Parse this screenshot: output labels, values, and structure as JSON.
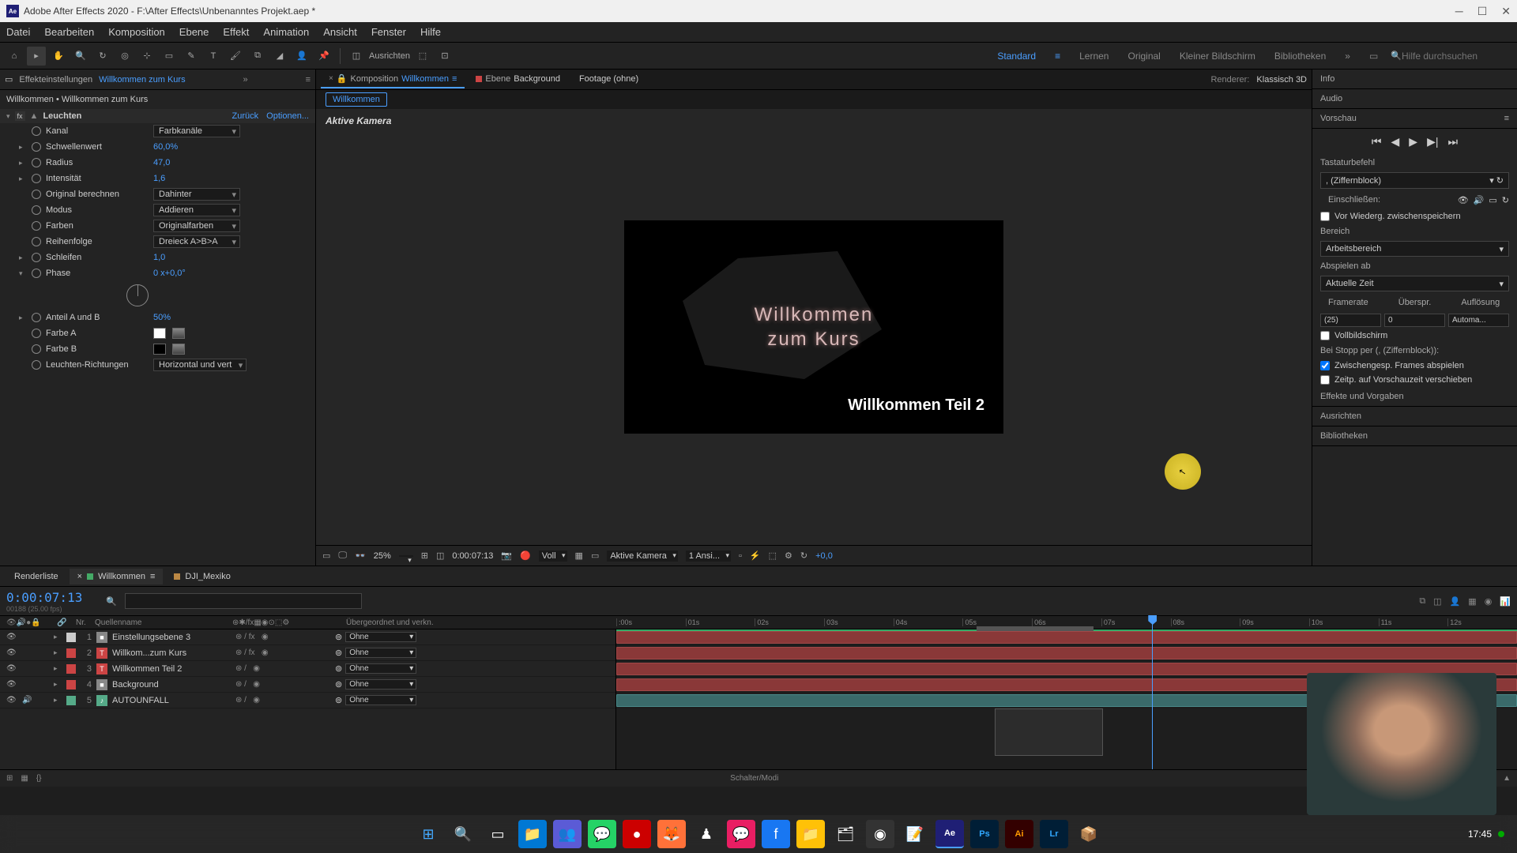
{
  "titlebar": {
    "app": "Adobe After Effects 2020",
    "path": "F:\\After Effects\\Unbenanntes Projekt.aep *"
  },
  "menu": [
    "Datei",
    "Bearbeiten",
    "Komposition",
    "Ebene",
    "Effekt",
    "Animation",
    "Ansicht",
    "Fenster",
    "Hilfe"
  ],
  "toolbar": {
    "ausrichten": "Ausrichten",
    "workspaces": [
      "Standard",
      "Lernen",
      "Original",
      "Kleiner Bildschirm",
      "Bibliotheken"
    ],
    "active_workspace": "Standard",
    "search_placeholder": "Hilfe durchsuchen"
  },
  "effect_controls": {
    "tab_label": "Effekteinstellungen",
    "tab_comp": "Willkommen zum Kurs",
    "breadcrumb": "Willkommen • Willkommen zum Kurs",
    "effect_name": "Leuchten",
    "reset": "Zurück",
    "options": "Optionen...",
    "props": {
      "kanal_label": "Kanal",
      "kanal_value": "Farbkanäle",
      "schwelle_label": "Schwellenwert",
      "schwelle_value": "60,0%",
      "radius_label": "Radius",
      "radius_value": "47,0",
      "intensitaet_label": "Intensität",
      "intensitaet_value": "1,6",
      "original_label": "Original berechnen",
      "original_value": "Dahinter",
      "modus_label": "Modus",
      "modus_value": "Addieren",
      "farben_label": "Farben",
      "farben_value": "Originalfarben",
      "reihenfolge_label": "Reihenfolge",
      "reihenfolge_value": "Dreieck A>B>A",
      "schleifen_label": "Schleifen",
      "schleifen_value": "1,0",
      "phase_label": "Phase",
      "phase_value": "0 x+0,0°",
      "anteil_label": "Anteil A und B",
      "anteil_value": "50%",
      "farbeA_label": "Farbe A",
      "farbeB_label": "Farbe B",
      "richtungen_label": "Leuchten-Richtungen",
      "richtungen_value": "Horizontal und vert"
    }
  },
  "center": {
    "tab_comp_prefix": "Komposition",
    "tab_comp": "Willkommen",
    "tab_layer_prefix": "Ebene",
    "tab_layer": "Background",
    "tab_footage": "Footage  (ohne)",
    "renderer_label": "Renderer:",
    "renderer_value": "Klassisch 3D",
    "crumb": "Willkommen",
    "viewer_label": "Aktive Kamera",
    "text_line1": "Willkommen",
    "text_line2": "zum Kurs",
    "text_sub": "Willkommen Teil 2",
    "footer": {
      "zoom": "25%",
      "timecode": "0:00:07:13",
      "resolution": "Voll",
      "camera": "Aktive Kamera",
      "views": "1 Ansi...",
      "exposure": "+0,0"
    }
  },
  "right": {
    "info": "Info",
    "audio": "Audio",
    "vorschau": "Vorschau",
    "tastatur": "Tastaturbefehl",
    "tastatur_val": ", (Ziffernblock)",
    "einschliessen": "Einschließen:",
    "vorwieder": "Vor Wiederg. zwischenspeichern",
    "bereich": "Bereich",
    "bereich_val": "Arbeitsbereich",
    "abspielen": "Abspielen ab",
    "abspielen_val": "Aktuelle Zeit",
    "framerate": "Framerate",
    "ueberspr": "Überspr.",
    "aufloesung": "Auflösung",
    "fr_val": "(25)",
    "ue_val": "0",
    "auf_val": "Automa...",
    "vollbild": "Vollbildschirm",
    "stopp": "Bei Stopp per (, (Ziffernblock)):",
    "zwischen": "Zwischengesp. Frames abspielen",
    "zeitp": "Zeitp. auf Vorschauzeit verschieben",
    "effekte": "Effekte und Vorgaben",
    "ausrichten": "Ausrichten",
    "biblio": "Bibliotheken"
  },
  "timeline": {
    "render_tab": "Renderliste",
    "comp_tab": "Willkommen",
    "dji_tab": "DJI_Mexiko",
    "timecode": "0:00:07:13",
    "timecode_sub": "00188 (25.00 fps)",
    "col_nr": "Nr.",
    "col_name": "Quellenname",
    "col_parent": "Übergeordnet und verkn.",
    "ticks": [
      ":00s",
      "01s",
      "02s",
      "03s",
      "04s",
      "05s",
      "06s",
      "07s",
      "08s",
      "09s",
      "10s",
      "11s",
      "12s"
    ],
    "layers": [
      {
        "num": "1",
        "color": "#ccc",
        "type": "■",
        "name": "Einstellungsebene 3",
        "parent": "Ohne",
        "fx": true
      },
      {
        "num": "2",
        "color": "#c44",
        "type": "T",
        "name": "Willkom...zum Kurs",
        "parent": "Ohne",
        "fx": true
      },
      {
        "num": "3",
        "color": "#c44",
        "type": "T",
        "name": "Willkommen Teil 2",
        "parent": "Ohne",
        "fx": false
      },
      {
        "num": "4",
        "color": "#c44",
        "type": "■",
        "name": "Background",
        "parent": "Ohne",
        "fx": false
      },
      {
        "num": "5",
        "color": "#5a8",
        "type": "♪",
        "name": "AUTOUNFALL",
        "parent": "Ohne",
        "fx": false
      }
    ],
    "footer": "Schalter/Modi"
  },
  "taskbar": {
    "time": "17:45"
  }
}
